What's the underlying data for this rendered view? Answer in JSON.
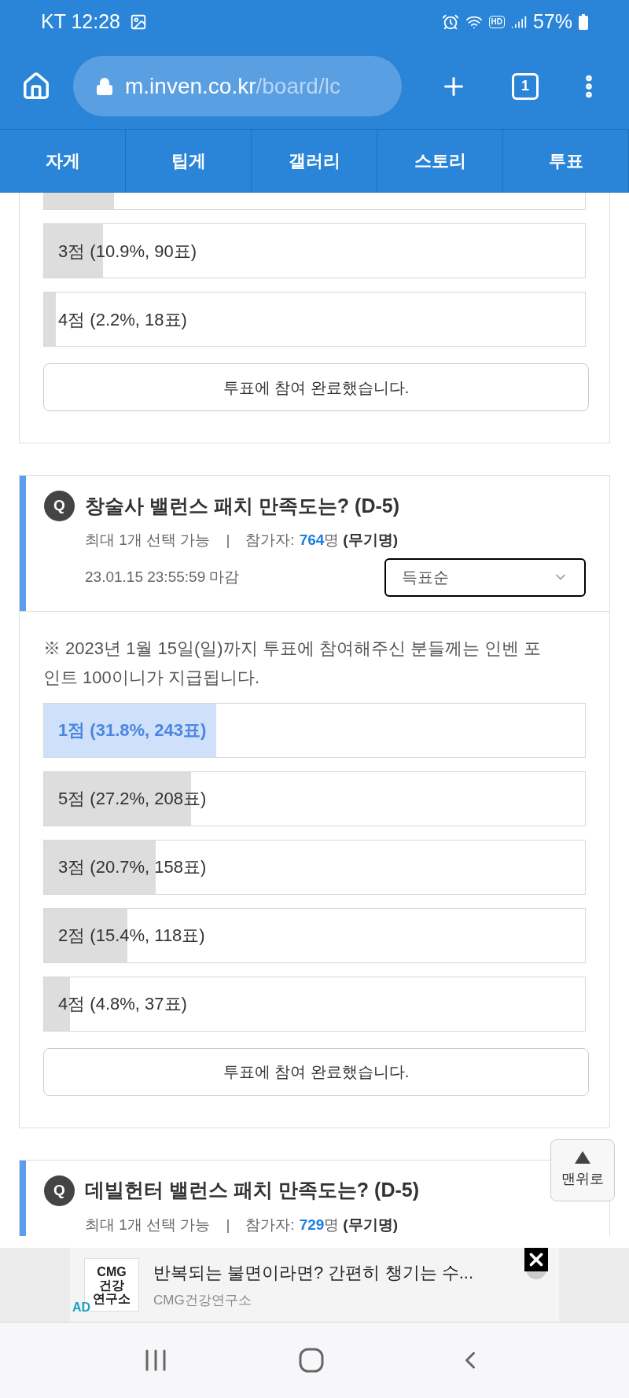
{
  "status_bar": {
    "carrier_time": "KT 12:28",
    "battery": "57%",
    "network_label": "HD"
  },
  "browser": {
    "url_host": "m.inven.co.kr",
    "url_path": "/board/lc",
    "tab_count": "1"
  },
  "nav_tabs": [
    {
      "label": "자게"
    },
    {
      "label": "팁게"
    },
    {
      "label": "갤러리"
    },
    {
      "label": "스토리"
    },
    {
      "label": "투표"
    }
  ],
  "polls": [
    {
      "options": [
        {
          "level": 0.13,
          "selected": false
        },
        {
          "label": "3점 (10.9%, 90표)",
          "level": 0.109,
          "selected": false
        },
        {
          "label": "4점 (2.2%, 18표)",
          "level": 0.022,
          "selected": false
        }
      ],
      "done_button": "투표에 참여 완료했습니다."
    },
    {
      "badge": "Q",
      "title": "창술사 밸런스 패치 만족도는? (D-5)",
      "limit": "최대 1개 선택 가능",
      "separator": "|",
      "participants_label": "참가자:",
      "participants_count": "764",
      "participants_unit": "명",
      "anonymous": "(무기명)",
      "deadline": "23.01.15 23:55:59 마감",
      "sort": "득표순",
      "note": "※ 2023년 1월 15일(일)까지 투표에 참여해주신 분들께는 인벤 포인트 100이니가 지급됩니다.",
      "options": [
        {
          "label": "1점 (31.8%, 243표)",
          "level": 0.318,
          "selected": true
        },
        {
          "label": "5점 (27.2%, 208표)",
          "level": 0.272,
          "selected": false
        },
        {
          "label": "3점 (20.7%, 158표)",
          "level": 0.207,
          "selected": false
        },
        {
          "label": "2점 (15.4%, 118표)",
          "level": 0.154,
          "selected": false
        },
        {
          "label": "4점 (4.8%, 37표)",
          "level": 0.048,
          "selected": false
        }
      ],
      "done_button": "투표에 참여 완료했습니다."
    },
    {
      "badge": "Q",
      "title": "데빌헌터 밸런스 패치 만족도는? (D-5)",
      "limit": "최대 1개 선택 가능",
      "separator": "|",
      "participants_label": "참가자:",
      "participants_count": "729",
      "participants_unit": "명",
      "anonymous": "(무기명)"
    }
  ],
  "back_to_top": {
    "label": "맨위로"
  },
  "ad": {
    "badge": "AD",
    "logo_lines": [
      "CMG",
      "건강",
      "연구소"
    ],
    "title": "반복되는 불면이라면? 간편히 챙기는 수...",
    "source": "CMG건강연구소"
  }
}
